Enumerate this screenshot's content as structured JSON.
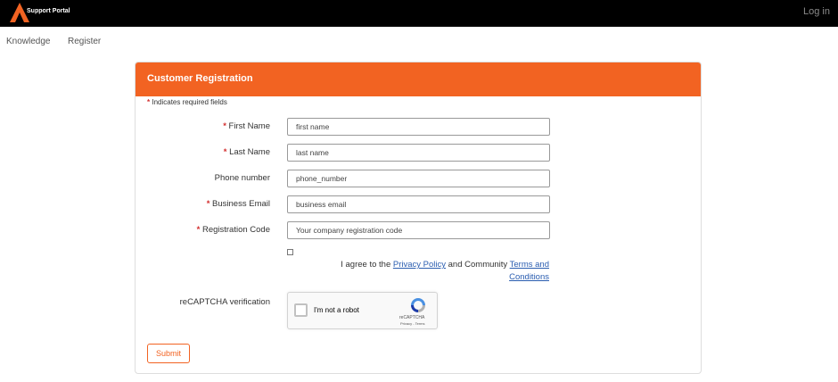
{
  "header": {
    "brand": "Support Portal",
    "login_label": "Log in"
  },
  "nav": {
    "items": [
      "Knowledge",
      "Register"
    ]
  },
  "form": {
    "title": "Customer Registration",
    "required_note": "Indicates required fields",
    "required_star": "*",
    "fields": [
      {
        "label": "First Name",
        "placeholder": "first name",
        "required": true
      },
      {
        "label": "Last Name",
        "placeholder": "last name",
        "required": true
      },
      {
        "label": "Phone number",
        "placeholder": "phone_number",
        "required": false
      },
      {
        "label": "Business Email",
        "placeholder": "business email",
        "required": true
      },
      {
        "label": "Registration Code",
        "placeholder": "Your company registration code",
        "required": true
      }
    ],
    "agree": {
      "prefix": "I agree to the",
      "privacy_link": "Privacy Policy",
      "middle": "and Community",
      "terms_link": "Terms and Conditions"
    },
    "recaptcha_label": "reCAPTCHA verification",
    "recaptcha": {
      "checkbox_text": "I'm not a robot",
      "brand": "reCAPTCHA",
      "links": "Privacy - Terms"
    },
    "submit_label": "Submit"
  },
  "colors": {
    "accent": "#f26322",
    "topbar": "#000000",
    "required": "#d32f2f",
    "link": "#2a5db0"
  }
}
